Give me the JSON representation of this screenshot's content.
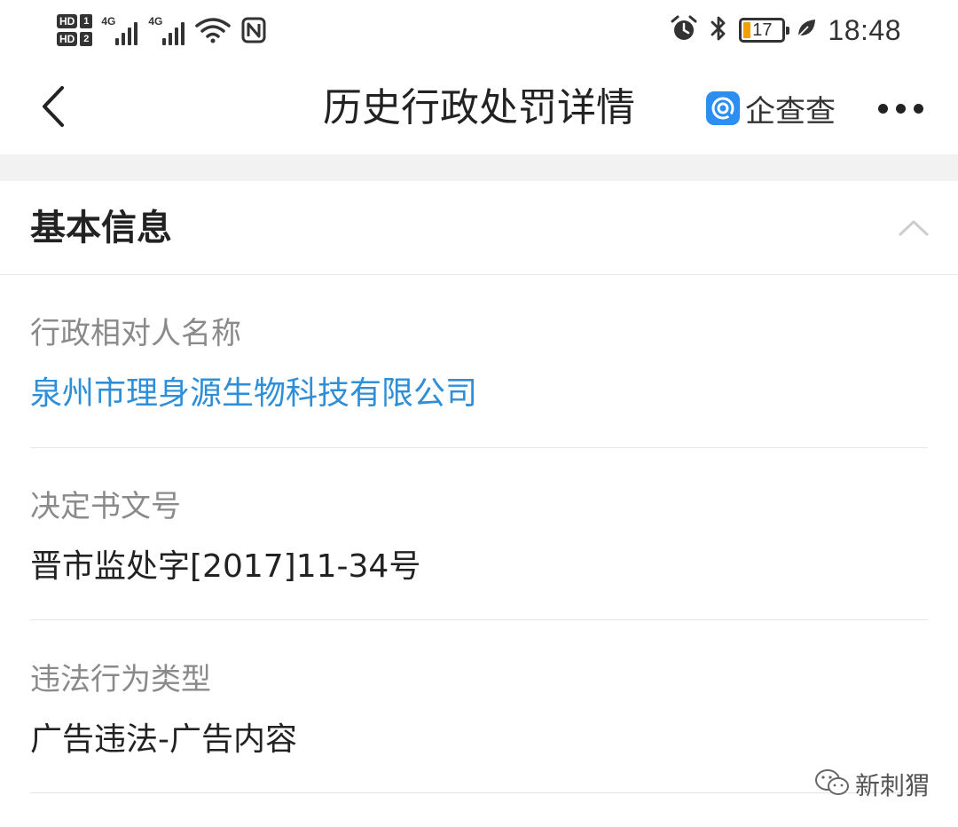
{
  "status_bar": {
    "hd1": "HD",
    "sim1": "1",
    "hd2": "HD",
    "sim2": "2",
    "network1": "4G",
    "network2": "4G",
    "battery_level": "17",
    "time": "18:48",
    "icons": [
      "signal-icon",
      "wifi-icon",
      "nfc-icon",
      "alarm-icon",
      "bluetooth-icon",
      "battery-icon",
      "leaf-icon"
    ],
    "battery_color": "#f0a000"
  },
  "nav": {
    "title": "历史行政处罚详情",
    "brand": "企查查",
    "brand_color": "#2b8ef0",
    "back_icon": "chevron-left-icon",
    "more_icon": "more-horizontal-icon"
  },
  "section": {
    "title": "基本信息",
    "collapse_icon": "chevron-up-icon"
  },
  "fields": [
    {
      "label": "行政相对人名称",
      "value": "泉州市理身源生物科技有限公司"
    },
    {
      "label": "决定书文号",
      "value": "晋市监处字[2017]11-34号"
    },
    {
      "label": "违法行为类型",
      "value": "广告违法-广告内容"
    }
  ],
  "colors": {
    "link": "#2e8fd8",
    "label": "#8a8a8a"
  },
  "watermark": {
    "text": "新刺猬",
    "icon": "wechat-icon"
  }
}
